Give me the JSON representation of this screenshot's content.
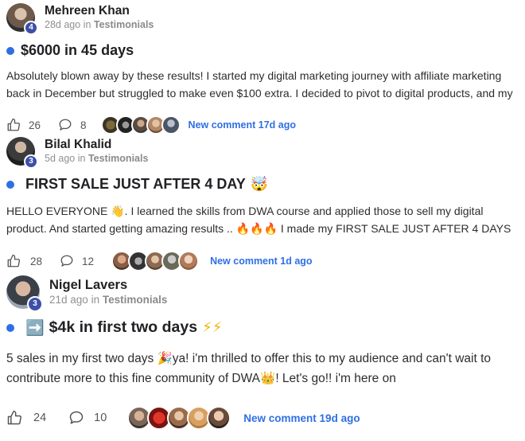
{
  "posts": [
    {
      "author": "Mehreen Khan",
      "level": "4",
      "time_ago": "28d ago",
      "in_word": "in",
      "category": "Testimonials",
      "title": "$6000 in 45 days",
      "body": "Absolutely blown away by these results! I started my digital marketing journey with affiliate marketing back in December but struggled to make even $100 extra. I decided to pivot to digital products, and my",
      "likes": "26",
      "comments": "8",
      "new_comment": "New comment 17d ago"
    },
    {
      "author": "Bilal Khalid",
      "level": "3",
      "time_ago": "5d ago",
      "in_word": "in",
      "category": "Testimonials",
      "title": "FIRST SALE JUST AFTER 4 DAY",
      "title_emoji": "🤯",
      "body": "HELLO EVERYONE 👋. I learned the skills from DWA course and applied those to sell my digital product. And started getting amazing results .. 🔥🔥🔥 I made my FIRST SALE JUST AFTER 4 DAYS",
      "likes": "28",
      "comments": "12",
      "new_comment": "New comment 1d ago"
    },
    {
      "author": "Nigel Lavers",
      "level": "3",
      "time_ago": "21d ago",
      "in_word": "in",
      "category": "Testimonials",
      "title_prefix_emoji": "➡️",
      "title": "$4k in first two days",
      "title_emoji": "⚡⚡",
      "body": "5 sales in my first two days 🎉ya! i'm thrilled to offer this to my audience and can't wait to contribute more to this fine community of DWA👑! Let's go!! i'm here on",
      "likes": "24",
      "comments": "10",
      "new_comment": "New comment 19d ago"
    }
  ],
  "icons": {
    "like": "thumbs-up-icon",
    "comment": "comment-bubble-icon"
  },
  "colors": {
    "accent": "#2f6fe4",
    "badge": "#3d4fa8",
    "meta": "#909090"
  }
}
